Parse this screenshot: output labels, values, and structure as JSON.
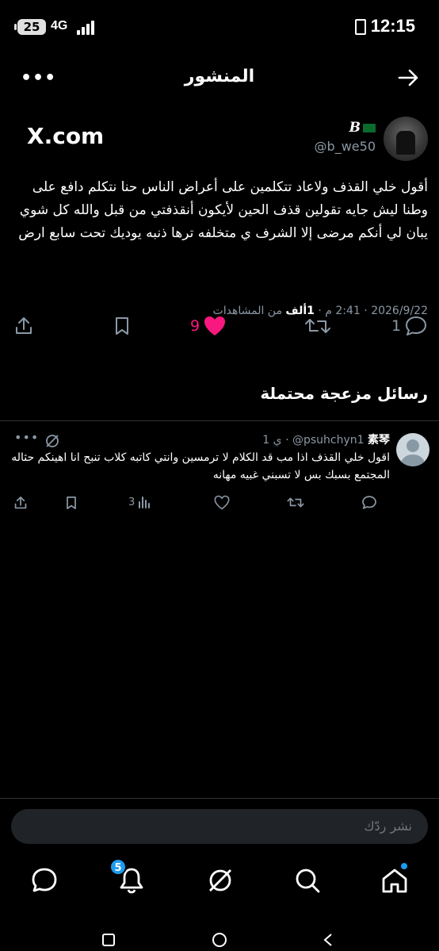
{
  "status_bar": {
    "battery": "25",
    "network": "4G",
    "time": "12:15"
  },
  "header": {
    "title": "المنشور",
    "more": "•••"
  },
  "author": {
    "site_logo": "X.com",
    "display_name": "B",
    "flag_icon": "saudi-flag-icon",
    "handle": "@b_we50"
  },
  "post": {
    "text": "أقول خلي القذف ولاعاد تتكلمين على أعراض الناس حنا نتكلم دافع على وطنا ليش جايه تقولين قذف الحين لأيكون أنقذفتي من قبل والله كل شوي يبان لي أنكم مرضى إلا الشرف ي متخلفه ترها ذنبه يوديك تحت سابع ارض",
    "date": "2026/9/22",
    "time": "2:41 م",
    "views_count": "1ألف",
    "views_label": "من المشاهدات",
    "replies": "1",
    "likes": "9"
  },
  "section": {
    "title": "رسائل مزعجة محتملة"
  },
  "reply": {
    "name": "素琴",
    "handle": "@psuhchyn1",
    "age": "1 ي",
    "text": "اقول خلي القذف اذا مب قد الكلام لا ترمسين وانتي كاتبه كلاب تنبح انا اهينكم حثاله المجتمع بسبك بس لا تسبني غبيه مهانه",
    "views": "3",
    "more": "•••"
  },
  "composer": {
    "placeholder": "نشر ردّك"
  },
  "tabbar": {
    "notifications_badge": "5"
  },
  "colors": {
    "accent": "#1d9bf0",
    "like": "#f91880",
    "muted": "#8b98a5",
    "background": "#000000"
  }
}
